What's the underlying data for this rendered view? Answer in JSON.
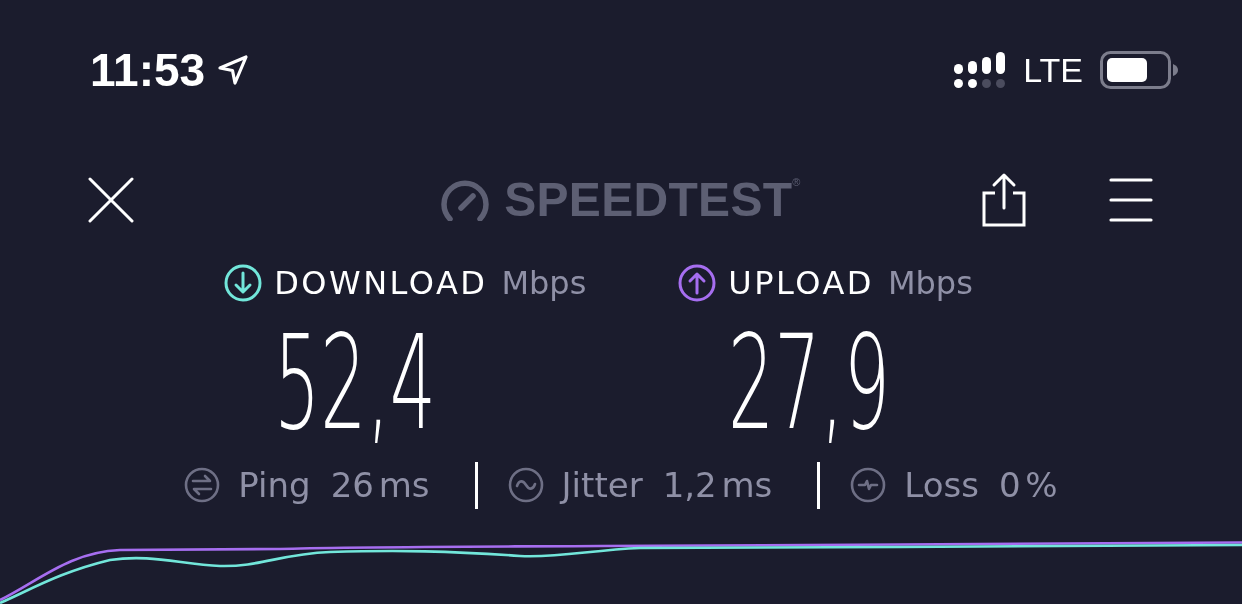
{
  "status_bar": {
    "time": "11:53",
    "network": "LTE"
  },
  "toolbar": {
    "logo": "SPEEDTEST$^{®}$"
  },
  "results": [
    {
      "kind": "download",
      "label": "DOWNLOAD",
      "unit": "Mbps",
      "value": "52,4",
      "color": "#72e6da"
    },
    {
      "kind": "upload",
      "label": "UPLOAD",
      "unit": "Mbps",
      "value": "27,9",
      "color": "#a66ef0"
    }
  ],
  "metrics": [
    {
      "kind": "ping",
      "label": "Ping",
      "value": "26 ms"
    },
    {
      "kind": "jitter",
      "label": "Jitter",
      "value": "1,2 ms"
    },
    {
      "kind": "loss",
      "label": "Loss",
      "value": "0 %"
    }
  ]
}
